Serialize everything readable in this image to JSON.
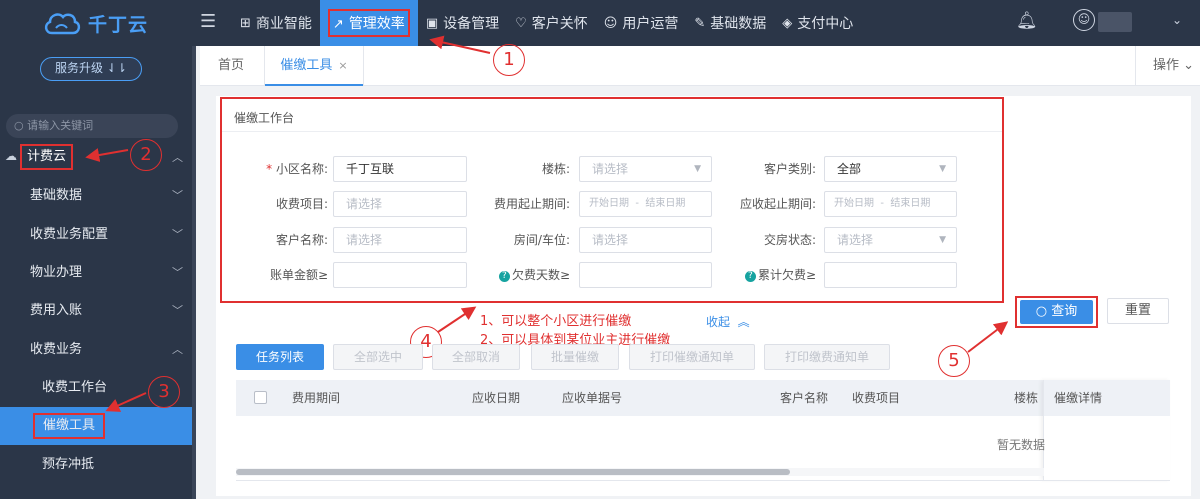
{
  "app": {
    "logo_text": "千丁云"
  },
  "topnav": {
    "items": [
      {
        "label": "商业智能",
        "icon": "chart-bar-icon"
      },
      {
        "label": "管理效率",
        "icon": "trend-line-icon",
        "active": true
      },
      {
        "label": "设备管理",
        "icon": "device-icon"
      },
      {
        "label": "客户关怀",
        "icon": "heart-icon"
      },
      {
        "label": "用户运营",
        "icon": "user-ops-icon"
      },
      {
        "label": "基础数据",
        "icon": "wrench-icon"
      },
      {
        "label": "支付中心",
        "icon": "shield-pay-icon"
      }
    ]
  },
  "sidebar": {
    "upgrade_label": "服务升级 ⇃⇂",
    "search_placeholder": "请输入关键词",
    "group_label": "计费云",
    "items": [
      {
        "label": "基础数据"
      },
      {
        "label": "收费业务配置"
      },
      {
        "label": "物业办理"
      },
      {
        "label": "费用入账"
      },
      {
        "label": "收费业务"
      },
      {
        "label": "收费工作台"
      },
      {
        "label": "催缴工具",
        "active": true
      },
      {
        "label": "预存冲抵"
      }
    ]
  },
  "tabs": {
    "home": "首页",
    "active": "催缴工具",
    "close": "×",
    "ops": "操作 ⌄"
  },
  "form": {
    "title": "催缴工作台",
    "fields": {
      "community_label": "小区名称:",
      "community_value": "千丁互联",
      "building_label": "楼栋:",
      "building_placeholder": "请选择",
      "customer_type_label": "客户类别:",
      "customer_type_value": "全部",
      "fee_item_label": "收费项目:",
      "fee_item_placeholder": "请选择",
      "fee_period_label": "费用起止期间:",
      "fee_period_start": "开始日期",
      "fee_period_sep": "-",
      "fee_period_end": "结束日期",
      "receivable_period_label": "应收起止期间:",
      "receivable_start": "开始日期",
      "receivable_sep": "-",
      "receivable_end": "结束日期",
      "customer_name_label": "客户名称:",
      "customer_name_placeholder": "请选择",
      "room_label": "房间/车位:",
      "room_placeholder": "请选择",
      "delivery_label": "交房状态:",
      "delivery_placeholder": "请选择",
      "bill_amount_label": "账单金额≥",
      "overdue_days_label": "欠费天数≥",
      "total_overdue_label": "累计欠费≥"
    },
    "search_label": "查询",
    "reset_label": "重置",
    "collapse_label": "收起"
  },
  "annotations": {
    "circles": [
      "1",
      "2",
      "3",
      "4",
      "5"
    ],
    "note_line1": "1、可以整个小区进行催缴",
    "note_line2": "2、可以具体到某位业主进行催缴"
  },
  "toolbar": {
    "task_list": "任务列表",
    "select_all": "全部选中",
    "cancel_all": "全部取消",
    "batch_remind": "批量催缴",
    "print_notice": "打印催缴通知单",
    "print_fee_notice": "打印缴费通知单"
  },
  "table": {
    "columns": [
      "费用期间",
      "应收日期",
      "应收单据号",
      "客户名称",
      "收费项目",
      "楼栋",
      "催缴详情"
    ],
    "empty_text": "暂无数据"
  },
  "colors": {
    "accent": "#3a8ee6",
    "annotation": "#e03030",
    "sidebar_bg": "#2b3648"
  }
}
